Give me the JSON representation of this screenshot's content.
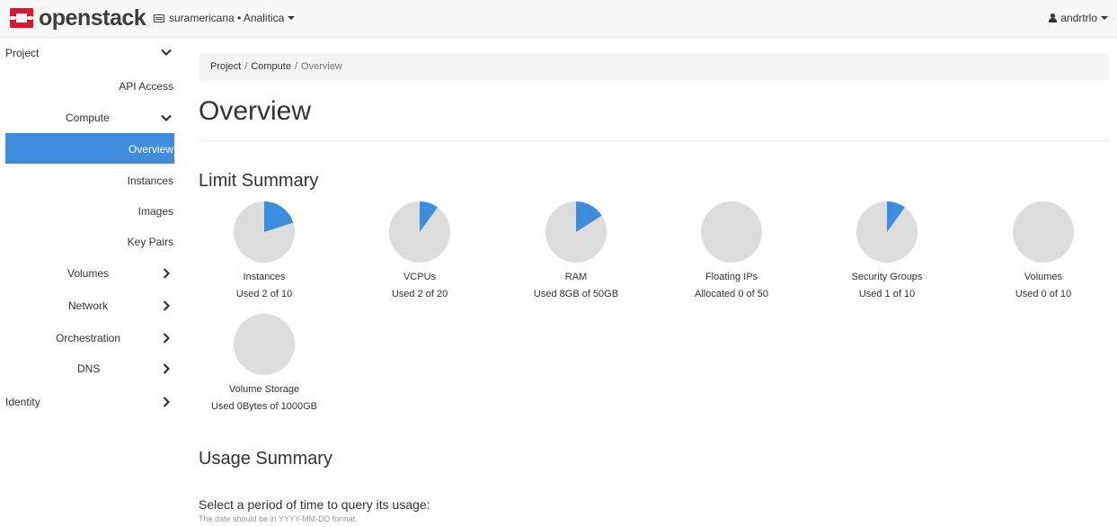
{
  "header": {
    "brand": "openstack",
    "brand_suffix": ".",
    "project_picker": "suramericana • Analitica",
    "user": "andrtrlo"
  },
  "sidebar": {
    "project": "Project",
    "api_access": "API Access",
    "compute": "Compute",
    "overview": "Overview",
    "instances": "Instances",
    "images": "Images",
    "key_pairs": "Key Pairs",
    "volumes": "Volumes",
    "network": "Network",
    "orchestration": "Orchestration",
    "dns": "DNS",
    "identity": "Identity"
  },
  "breadcrumb": {
    "items": [
      "Project",
      "Compute",
      "Overview"
    ],
    "separator": "/"
  },
  "page": {
    "title": "Overview",
    "limit_summary_title": "Limit Summary",
    "usage_summary_title": "Usage Summary",
    "query_label": "Select a period of time to query its usage:",
    "query_help": "The date should be in YYYY-MM-DD format."
  },
  "colors": {
    "used": "#3e8ddd",
    "unused": "#dddddd",
    "active_nav": "#3e8ddd"
  },
  "limits": [
    {
      "name": "Instances",
      "used_text": "Used 2 of 10",
      "used_fraction": 0.2
    },
    {
      "name": "VCPUs",
      "used_text": "Used 2 of 20",
      "used_fraction": 0.1
    },
    {
      "name": "RAM",
      "used_text": "Used 8GB of 50GB",
      "used_fraction": 0.16
    },
    {
      "name": "Floating IPs",
      "used_text": "Allocated 0 of 50",
      "used_fraction": 0
    },
    {
      "name": "Security Groups",
      "used_text": "Used 1 of 10",
      "used_fraction": 0.1
    },
    {
      "name": "Volumes",
      "used_text": "Used 0 of 10",
      "used_fraction": 0
    },
    {
      "name": "Volume Storage",
      "used_text": "Used 0Bytes of 1000GB",
      "used_fraction": 0
    }
  ]
}
